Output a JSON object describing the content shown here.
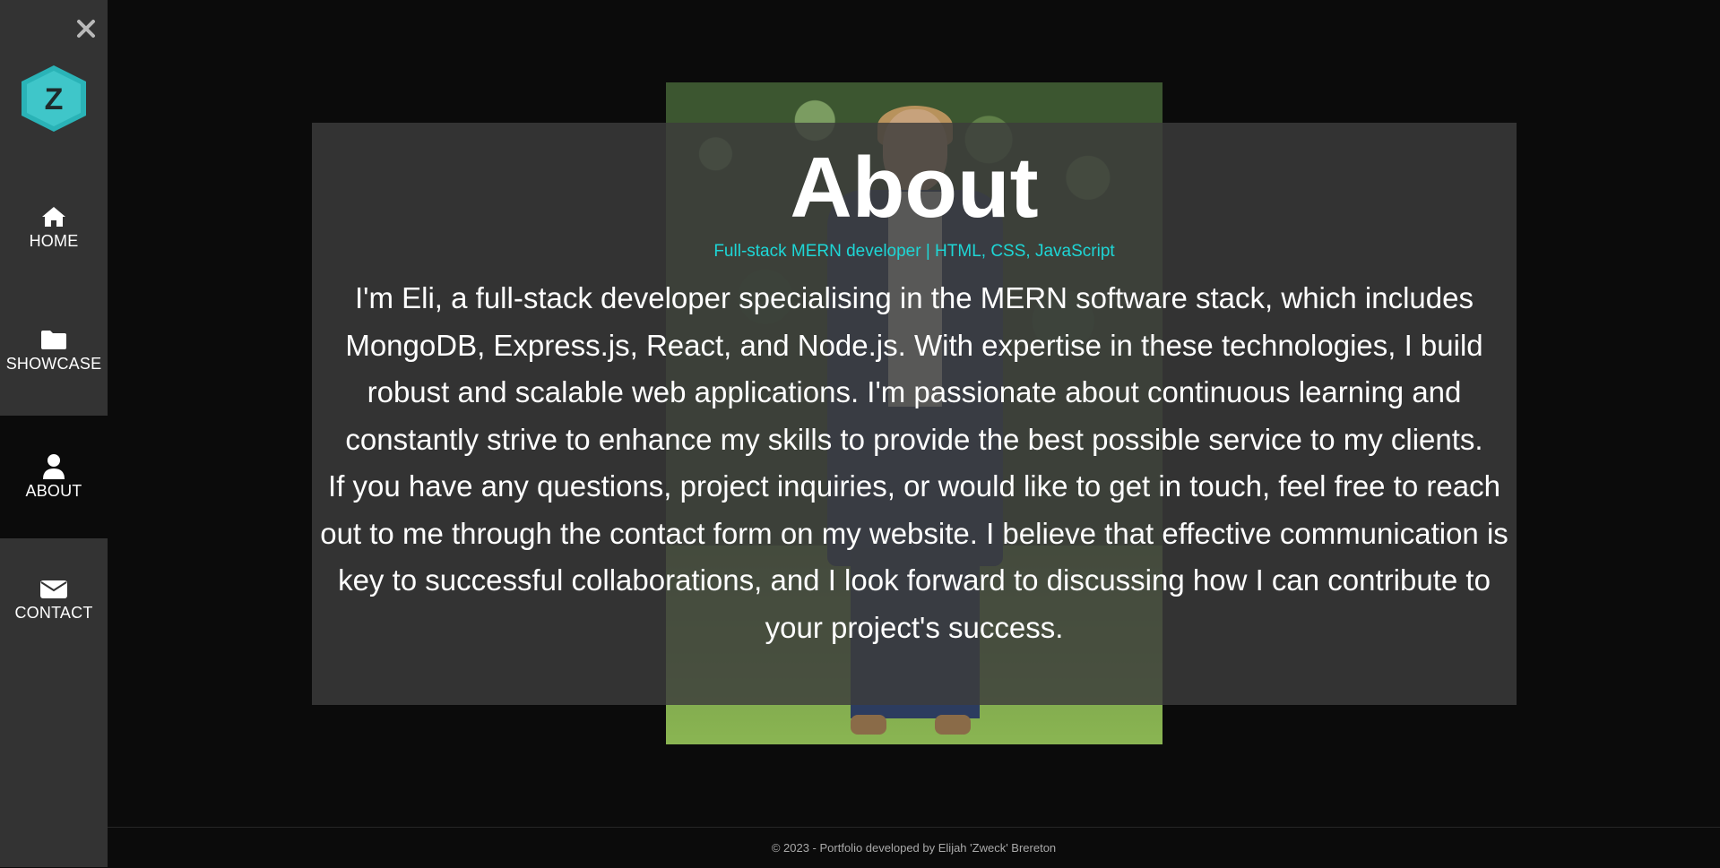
{
  "sidebar": {
    "close_icon": "close-icon",
    "logo": {
      "letter": "Z",
      "colors": {
        "fill": "#3fc6c9",
        "stroke": "#2ab3b7",
        "letter": "#1f2a2a"
      }
    },
    "items": [
      {
        "label": "HOME",
        "icon": "home-icon",
        "active": false
      },
      {
        "label": "SHOWCASE",
        "icon": "folder-icon",
        "active": false
      },
      {
        "label": "ABOUT",
        "icon": "user-icon",
        "active": true
      },
      {
        "label": "CONTACT",
        "icon": "envelope-icon",
        "active": false
      }
    ]
  },
  "about": {
    "title": "About",
    "subtitle": "Full-stack MERN developer | HTML, CSS, JavaScript",
    "paragraphs": [
      "I'm Eli, a full-stack developer specialising in the MERN software stack, which includes MongoDB, Express.js, React, and Node.js. With expertise in these technologies, I build robust and scalable web applications. I'm passionate about continuous learning and constantly strive to enhance my skills to provide the best possible service to my clients.",
      "If you have any questions, project inquiries, or would like to get in touch, feel free to reach out to me through the contact form on my website. I believe that effective communication is key to successful collaborations, and I look forward to discussing how I can contribute to your project's success."
    ]
  },
  "footer": {
    "text": "© 2023 - Portfolio developed by Elijah 'Zweck' Brereton"
  },
  "colors": {
    "sidebar_bg": "#333333",
    "page_bg": "#0b0b0b",
    "accent": "#1ed6d6"
  }
}
